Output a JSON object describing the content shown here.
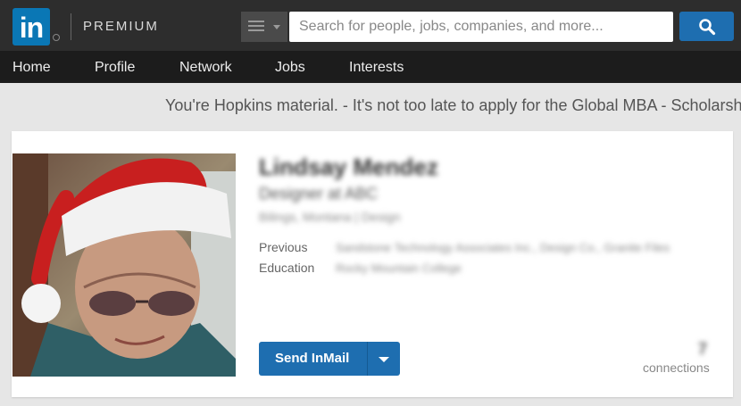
{
  "header": {
    "logo_text": "in",
    "premium_label": "PREMIUM",
    "search_placeholder": "Search for people, jobs, companies, and more...",
    "icons": [
      "linkedin-logo",
      "menu-icon",
      "search-icon"
    ]
  },
  "nav": {
    "items": [
      {
        "label": "Home"
      },
      {
        "label": "Profile"
      },
      {
        "label": "Network"
      },
      {
        "label": "Jobs"
      },
      {
        "label": "Interests"
      }
    ]
  },
  "ad": {
    "text": "You're Hopkins material. - It's not too late to apply for the Global MBA - Scholarsh"
  },
  "profile": {
    "name": "Lindsay Mendez",
    "headline": "Designer at ABC",
    "location": "Bilings, Montana | Design",
    "previous_label": "Previous",
    "previous_value": "Sandstone Technology Associates Inc., Design Co., Granite Files",
    "education_label": "Education",
    "education_value": "Rocky Mountain College",
    "send_inmail_label": "Send InMail",
    "connections_count": "7",
    "connections_label": "connections"
  },
  "colors": {
    "brand_blue": "#0a77b5",
    "button_blue": "#1e6eb0",
    "topbar": "#2d2d2d",
    "navbar": "#1c1c1c"
  }
}
